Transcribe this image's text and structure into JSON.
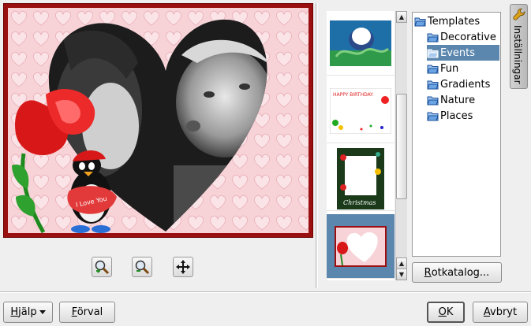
{
  "preview": {
    "image_description": "Black and white photo of two children inside a heart-shaped frame with pink hearts background, rose and penguin clip art",
    "penguin_heart_text": "I Love You"
  },
  "zoom_toolbar": {
    "zoom_in_icon": "zoom-in-icon",
    "zoom_out_icon": "zoom-out-icon",
    "fit_icon": "move-icon"
  },
  "thumbnails": {
    "items": [
      {
        "name": "underwater",
        "selected": false
      },
      {
        "name": "happy-birthday",
        "text": "HAPPY BIRTHDAY",
        "selected": false
      },
      {
        "name": "christmas",
        "text": "Christmas",
        "selected": false
      },
      {
        "name": "heart-rose",
        "selected": true
      }
    ]
  },
  "tree": {
    "root": "Templates",
    "children": [
      {
        "label": "Decorative",
        "selected": false
      },
      {
        "label": "Events",
        "selected": true
      },
      {
        "label": "Fun",
        "selected": false
      },
      {
        "label": "Gradients",
        "selected": false
      },
      {
        "label": "Nature",
        "selected": false
      },
      {
        "label": "Places",
        "selected": false
      }
    ]
  },
  "root_button": {
    "label": "Rotkatalog...",
    "mnemonic": "R",
    "rest": "otkatalog..."
  },
  "side_tab": {
    "label": "Inställningar"
  },
  "buttons": {
    "help": {
      "mnemonic": "H",
      "rest": "jälp"
    },
    "defaults": {
      "mnemonic": "F",
      "rest": "örval"
    },
    "ok": {
      "mnemonic": "O",
      "rest": "K"
    },
    "cancel": {
      "mnemonic": "A",
      "rest": "vbryt"
    }
  },
  "colors": {
    "selection": "#5b86ad",
    "frame_red": "#9a1010",
    "pink_bg": "#f5cdd2"
  }
}
